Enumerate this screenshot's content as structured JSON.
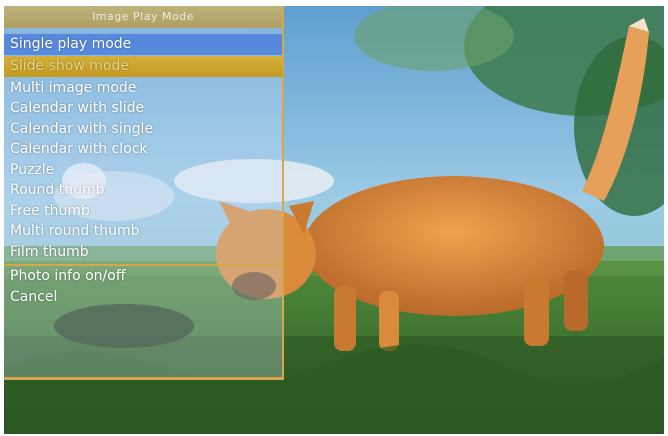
{
  "menu": {
    "title": "Image Play Mode",
    "items": [
      {
        "label": "Single play mode",
        "state": "selected"
      },
      {
        "label": "Slide show mode",
        "state": "highlight"
      },
      {
        "label": "Multi image mode",
        "state": ""
      },
      {
        "label": "Calendar with slide",
        "state": ""
      },
      {
        "label": "Calendar with single",
        "state": ""
      },
      {
        "label": "Calendar with clock",
        "state": ""
      },
      {
        "label": "Puzzle",
        "state": ""
      },
      {
        "label": "Round thumb",
        "state": ""
      },
      {
        "label": "Free thumb",
        "state": ""
      },
      {
        "label": "Multi round thumb",
        "state": ""
      },
      {
        "label": "Film thumb",
        "state": ""
      }
    ],
    "extra_items": [
      {
        "label": "Photo info on/off"
      },
      {
        "label": "Cancel"
      }
    ]
  },
  "photo": {
    "subject": "orange-kitten-in-grass",
    "colors": {
      "sky": "#8fc0e0",
      "grass": "#3f7a30",
      "cat": "#d98a3a",
      "accent": "#d9a64a"
    }
  }
}
